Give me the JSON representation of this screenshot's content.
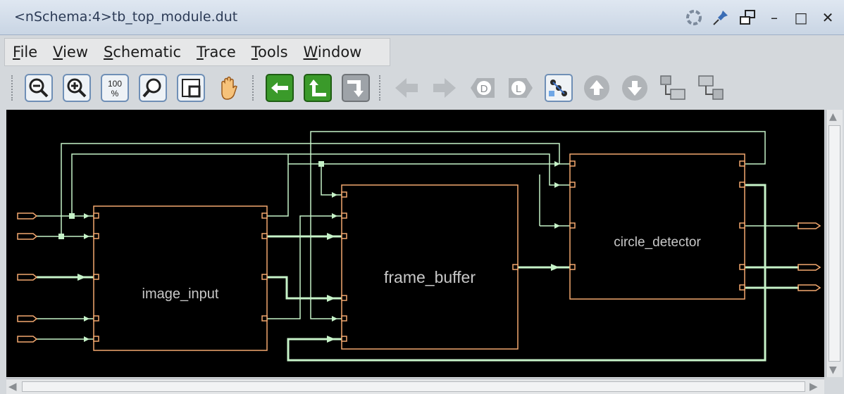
{
  "window": {
    "title": "<nSchema:4>tb_top_module.dut",
    "controls": [
      "spinner-icon",
      "pin-icon",
      "restore-icon",
      "minimize-icon",
      "maximize-icon",
      "close-icon"
    ],
    "minimize_glyph": "–",
    "maximize_glyph": "□",
    "close_glyph": "✕"
  },
  "menu": {
    "items": [
      {
        "accel": "F",
        "rest": "ile"
      },
      {
        "accel": "V",
        "rest": "iew"
      },
      {
        "accel": "S",
        "rest": "chematic"
      },
      {
        "accel": "T",
        "rest": "race"
      },
      {
        "accel": "T",
        "rest": "ools"
      },
      {
        "accel": "W",
        "rest": "indow"
      }
    ]
  },
  "toolbar": {
    "zoom_100_top": "100",
    "zoom_100_bottom": "%",
    "buttons": [
      "zoom-out",
      "zoom-in",
      "zoom-100",
      "zoom-fit",
      "zoom-box",
      "pan-hand",
      "backward-trace",
      "forward-trace-up",
      "forward-trace-down",
      "back",
      "forward",
      "driver-D",
      "load-L",
      "schematic-show",
      "up-hierarchy",
      "down-hierarchy",
      "collapse-window",
      "expand-window"
    ],
    "d_letter": "D",
    "l_letter": "L"
  },
  "schematic": {
    "blocks": [
      {
        "label": "image_input"
      },
      {
        "label": "frame_buffer"
      },
      {
        "label": "circle_detector"
      }
    ],
    "colors": {
      "background": "#000000",
      "block": "#f3a86f",
      "net": "#c6f2c8",
      "label": "#c8c8c8"
    }
  },
  "scroll": {
    "left_arrow": "◀",
    "right_arrow": "▶",
    "up_arrow": "▲",
    "down_arrow": "▼"
  }
}
